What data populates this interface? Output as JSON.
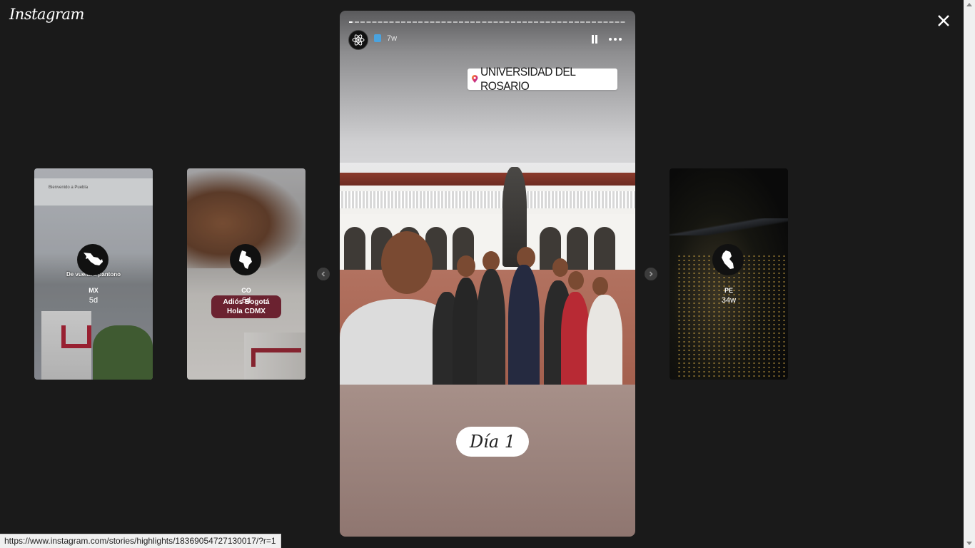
{
  "app": {
    "logo_text": "Instagram"
  },
  "controls": {
    "close_icon": "close-icon",
    "prev_icon": "chevron-left-icon",
    "next_icon": "chevron-right-icon"
  },
  "previews": [
    {
      "name": "MX",
      "time": "5d",
      "caption": "De vuelta a pantono",
      "banner": "Bienvenido a Puebla"
    },
    {
      "name": "CO",
      "time": "6d",
      "sticker_line1": "Adiós Bogotá",
      "sticker_line2": "Hola CDMX"
    },
    {
      "name": "PE",
      "time": "34w"
    }
  ],
  "story": {
    "time": "7w",
    "progress": 0.01,
    "location": "UNIVERSIDAD DEL ROSARIO",
    "day_label": "Día 1"
  },
  "status_bar": {
    "url": "https://www.instagram.com/stories/highlights/18369054727130017/?r=1"
  },
  "colors": {
    "background": "#1a1a1a",
    "accent_pin": "#e1306c"
  }
}
